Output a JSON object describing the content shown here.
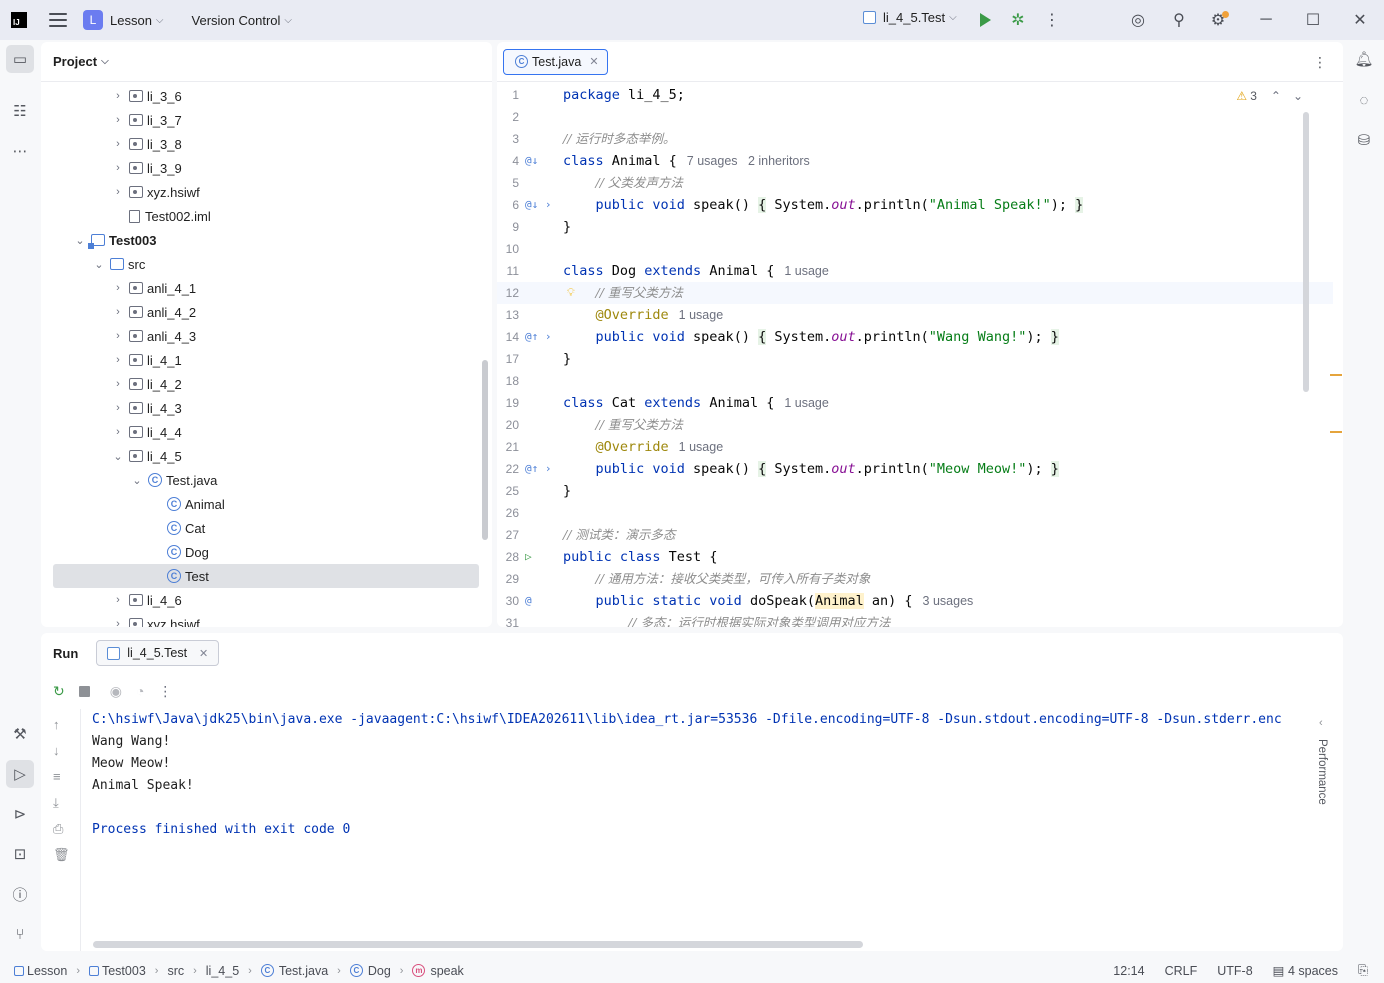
{
  "titlebar": {
    "project_badge": "L",
    "project_name": "Lesson",
    "vcs_label": "Version Control",
    "run_config": "li_4_5.Test",
    "notif_dot_color": "#f0a13a"
  },
  "project_panel": {
    "title": "Project",
    "tree": [
      {
        "label": "li_3_6",
        "indent": 3,
        "toggle": "›",
        "icon": "package"
      },
      {
        "label": "li_3_7",
        "indent": 3,
        "toggle": "›",
        "icon": "package"
      },
      {
        "label": "li_3_8",
        "indent": 3,
        "toggle": "›",
        "icon": "package"
      },
      {
        "label": "li_3_9",
        "indent": 3,
        "toggle": "›",
        "icon": "package"
      },
      {
        "label": "xyz.hsiwf",
        "indent": 3,
        "toggle": "›",
        "icon": "package"
      },
      {
        "label": "Test002.iml",
        "indent": 3,
        "toggle": "",
        "icon": "iml"
      },
      {
        "label": "Test003",
        "indent": 1,
        "toggle": "⌄",
        "icon": "module",
        "bold": true
      },
      {
        "label": "src",
        "indent": 2,
        "toggle": "⌄",
        "icon": "src"
      },
      {
        "label": "anli_4_1",
        "indent": 3,
        "toggle": "›",
        "icon": "package"
      },
      {
        "label": "anli_4_2",
        "indent": 3,
        "toggle": "›",
        "icon": "package"
      },
      {
        "label": "anli_4_3",
        "indent": 3,
        "toggle": "›",
        "icon": "package"
      },
      {
        "label": "li_4_1",
        "indent": 3,
        "toggle": "›",
        "icon": "package"
      },
      {
        "label": "li_4_2",
        "indent": 3,
        "toggle": "›",
        "icon": "package"
      },
      {
        "label": "li_4_3",
        "indent": 3,
        "toggle": "›",
        "icon": "package"
      },
      {
        "label": "li_4_4",
        "indent": 3,
        "toggle": "›",
        "icon": "package"
      },
      {
        "label": "li_4_5",
        "indent": 3,
        "toggle": "⌄",
        "icon": "package"
      },
      {
        "label": "Test.java",
        "indent": 4,
        "toggle": "⌄",
        "icon": "class"
      },
      {
        "label": "Animal",
        "indent": 5,
        "toggle": "",
        "icon": "class"
      },
      {
        "label": "Cat",
        "indent": 5,
        "toggle": "",
        "icon": "class"
      },
      {
        "label": "Dog",
        "indent": 5,
        "toggle": "",
        "icon": "class"
      },
      {
        "label": "Test",
        "indent": 5,
        "toggle": "",
        "icon": "class",
        "selected": true
      },
      {
        "label": "li_4_6",
        "indent": 3,
        "toggle": "›",
        "icon": "package"
      },
      {
        "label": "xyz.hsiwf",
        "indent": 3,
        "toggle": "›",
        "icon": "package"
      }
    ]
  },
  "editor": {
    "tab_label": "Test.java",
    "warning_count": "3",
    "lines": [
      {
        "n": "1",
        "html": "<span class=\"kw\">package</span> li_4_5;"
      },
      {
        "n": "2",
        "html": ""
      },
      {
        "n": "3",
        "html": "<span class=\"cm\">// 运行时多态举例。</span>"
      },
      {
        "n": "4",
        "gutter": "@↓",
        "html": "<span class=\"kw\">class</span> Animal {<span class=\"hint\">7 usages   2 inheritors</span>"
      },
      {
        "n": "5",
        "html": "    <span class=\"cm\">// 父类发声方法</span>"
      },
      {
        "n": "6",
        "gutter": "@↓ ›",
        "html": "    <span class=\"kw\">public void</span> speak() <span class=\"brace-hl\">{</span> System.<span class=\"it\">out</span>.println(<span class=\"str\">\"Animal Speak!\"</span>); <span class=\"brace-hl\">}</span>"
      },
      {
        "n": "9",
        "html": "}"
      },
      {
        "n": "10",
        "html": ""
      },
      {
        "n": "11",
        "html": "<span class=\"kw\">class</span> Dog <span class=\"kw\">extends</span> Animal {<span class=\"hint\">1 usage</span>"
      },
      {
        "n": "12",
        "current": true,
        "bulb": true,
        "html": "    <span class=\"cm\">// 重写父类方法</span>"
      },
      {
        "n": "13",
        "html": "    <span class=\"ann\">@Override</span><span class=\"hint\">1 usage</span>"
      },
      {
        "n": "14",
        "gutter": "@↑ ›",
        "html": "    <span class=\"kw\">public void</span> speak() <span class=\"brace-hl\">{</span> System.<span class=\"it\">out</span>.println(<span class=\"str\">\"Wang Wang!\"</span>); <span class=\"brace-hl\">}</span>"
      },
      {
        "n": "17",
        "html": "}"
      },
      {
        "n": "18",
        "html": ""
      },
      {
        "n": "19",
        "html": "<span class=\"kw\">class</span> Cat <span class=\"kw\">extends</span> Animal {<span class=\"hint\">1 usage</span>"
      },
      {
        "n": "20",
        "html": "    <span class=\"cm\">// 重写父类方法</span>"
      },
      {
        "n": "21",
        "html": "    <span class=\"ann\">@Override</span><span class=\"hint\">1 usage</span>"
      },
      {
        "n": "22",
        "gutter": "@↑ ›",
        "html": "    <span class=\"kw\">public void</span> speak() <span class=\"brace-hl\">{</span> System.<span class=\"it\">out</span>.println(<span class=\"str\">\"Meow Meow!\"</span>); <span class=\"brace-hl\">}</span>"
      },
      {
        "n": "25",
        "html": "}"
      },
      {
        "n": "26",
        "html": ""
      },
      {
        "n": "27",
        "html": "<span class=\"cm\">// 测试类：演示多态</span>"
      },
      {
        "n": "28",
        "gutter": "▷",
        "gutter_run": true,
        "html": "<span class=\"kw\">public class</span> Test {"
      },
      {
        "n": "29",
        "html": "    <span class=\"cm\">// 通用方法：接收父类类型，可传入所有子类对象</span>"
      },
      {
        "n": "30",
        "gutter": "@",
        "html": "    <span class=\"kw\">public static void</span> doSpeak(<span class=\"type-hl\">Animal</span> an) {<span class=\"hint\">3 usages</span>"
      },
      {
        "n": "31",
        "html": "        <span class=\"cm\">// 多态：运行时根据实际对象类型调用对应方法</span>"
      }
    ]
  },
  "run_panel": {
    "title": "Run",
    "tab_label": "li_4_5.Test",
    "side_label": "Performance",
    "console": [
      {
        "cls": "cmd",
        "text": "C:\\hsiwf\\Java\\jdk25\\bin\\java.exe -javaagent:C:\\hsiwf\\IDEA202611\\lib\\idea_rt.jar=53536 -Dfile.encoding=UTF-8 -Dsun.stdout.encoding=UTF-8 -Dsun.stderr.enc"
      },
      {
        "cls": "out",
        "text": "Wang Wang!"
      },
      {
        "cls": "out",
        "text": "Meow Meow!"
      },
      {
        "cls": "out",
        "text": "Animal Speak!"
      },
      {
        "cls": "out",
        "text": ""
      },
      {
        "cls": "exit",
        "text": "Process finished with exit code 0"
      }
    ]
  },
  "statusbar": {
    "breadcrumbs": [
      "Lesson",
      "Test003",
      "src",
      "li_4_5",
      "Test.java",
      "Dog",
      "speak"
    ],
    "position": "12:14",
    "line_sep": "CRLF",
    "encoding": "UTF-8",
    "indent": "4 spaces"
  }
}
